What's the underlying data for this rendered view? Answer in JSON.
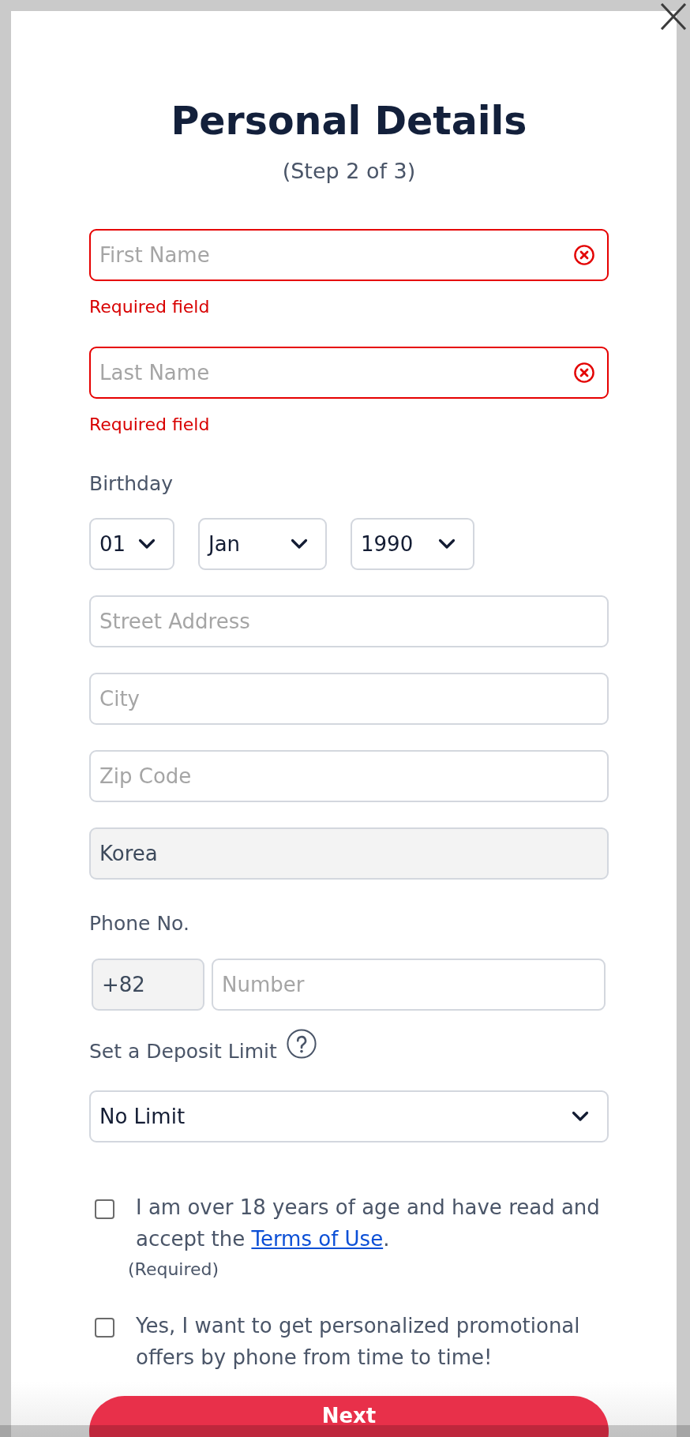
{
  "title": "Personal Details",
  "subtitle": "(Step 2 of 3)",
  "name_fields": [
    {
      "placeholder": "First Name",
      "error": true,
      "error_message": "Required field"
    },
    {
      "placeholder": "Last Name",
      "error": true,
      "error_message": "Required field"
    }
  ],
  "birthday": {
    "label": "Birthday",
    "selects": [
      {
        "value": "01"
      },
      {
        "value": "Jan"
      },
      {
        "value": "1990"
      }
    ]
  },
  "address_fields": [
    {
      "placeholder": "Street Address",
      "disabled": false
    },
    {
      "placeholder": "City",
      "disabled": false
    },
    {
      "placeholder": "Zip Code",
      "disabled": false
    },
    {
      "value": "Korea",
      "disabled": true
    }
  ],
  "phone": {
    "label": "Phone No.",
    "country_code": {
      "value": "+82",
      "disabled": true
    },
    "number": {
      "placeholder": "Number"
    }
  },
  "deposit_limit": {
    "label": "Set a Deposit Limit",
    "value": "No Limit"
  },
  "consents": [
    {
      "text": "I am over 18 years of age and have read and accept the ",
      "link": "Terms of Use",
      "text_after": ".",
      "note": "(Required)",
      "checked": false
    },
    {
      "text": "Yes, I want to get personalized promotional offers by phone from time to time!",
      "checked": false
    }
  ],
  "next_button": {
    "label": "Next"
  }
}
